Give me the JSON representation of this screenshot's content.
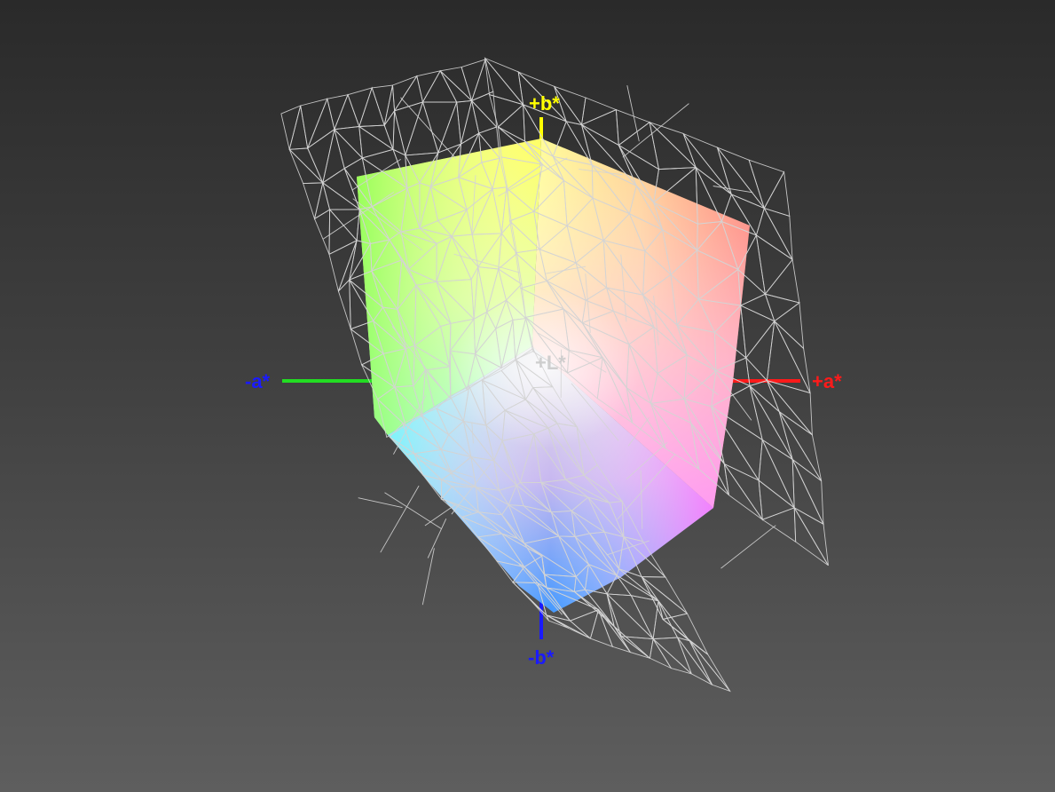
{
  "axes": {
    "plus_b": {
      "label": "+b*",
      "color": "#ffff00"
    },
    "minus_b": {
      "label": "-b*",
      "color": "#1a1aff"
    },
    "plus_a": {
      "label": "+a*",
      "color": "#ff1a1a"
    },
    "minus_a": {
      "label": "-a*",
      "color": "#1a1aff",
      "line_color": "#22dd22"
    },
    "plus_l": {
      "label": "+L*",
      "color": "#c8c8c8"
    }
  },
  "colors": {
    "background_top": "#2a2a2a",
    "background_bottom": "#5e5e5e",
    "wireframe": "#d4d4d4",
    "solid_yellow": "#ffff55",
    "solid_green": "#88ff55",
    "solid_red": "#ff7755",
    "solid_cyan": "#66ffff",
    "solid_blue": "#4499ff",
    "solid_magenta": "#ff77ff",
    "solid_white": "#ffffff"
  }
}
